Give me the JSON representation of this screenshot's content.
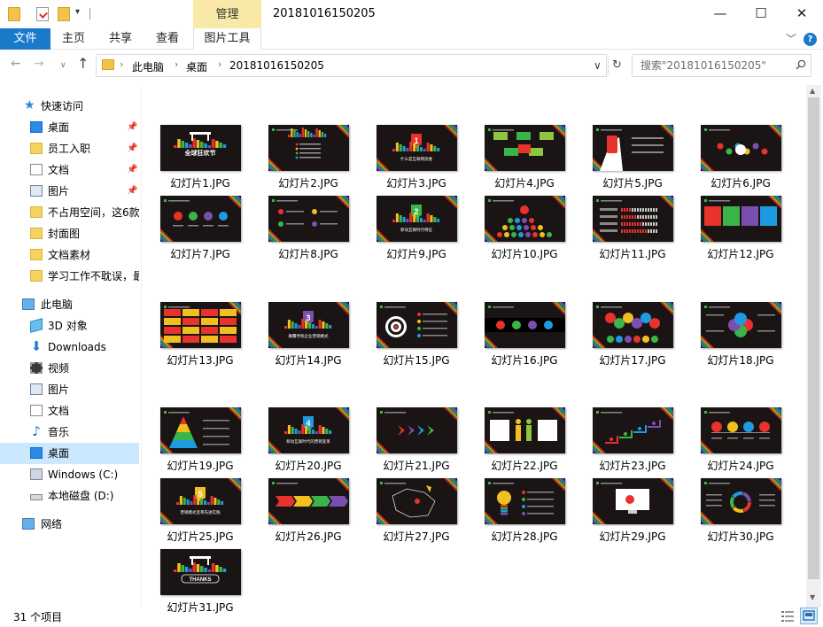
{
  "titlebar": {
    "tool_group": "管理",
    "title": "20181016150205",
    "minimize": "—",
    "maximize": "☐",
    "close": "✕",
    "qa_menu": "▾"
  },
  "ribbon": {
    "tabs": [
      "文件",
      "主页",
      "共享",
      "查看",
      "图片工具"
    ],
    "chevron": "﹀",
    "help": "?"
  },
  "navbar": {
    "back": "←",
    "forward": "→",
    "recent": "∨",
    "up": "↑",
    "breadcrumbs": [
      "此电脑",
      "桌面",
      "20181016150205"
    ],
    "separator": "›",
    "dropdown": "∨",
    "refresh": "↻",
    "search_placeholder": "搜索\"20181016150205\""
  },
  "navpane": {
    "quick_access": "快速访问",
    "items": [
      {
        "label": "桌面",
        "icon": "desktop-icon",
        "pinned": true
      },
      {
        "label": "员工入职",
        "icon": "folder-icon",
        "pinned": true
      },
      {
        "label": "文档",
        "icon": "document-icon",
        "pinned": true
      },
      {
        "label": "图片",
        "icon": "picture-icon",
        "pinned": true
      },
      {
        "label": "不占用空间，这6款",
        "icon": "folder-icon",
        "pinned": false
      },
      {
        "label": "封面图",
        "icon": "folder-icon",
        "pinned": false
      },
      {
        "label": "文档素材",
        "icon": "folder-icon",
        "pinned": false
      },
      {
        "label": "学习工作不耽误，最",
        "icon": "folder-icon",
        "pinned": false
      }
    ],
    "this_pc": "此电脑",
    "pc_items": [
      {
        "label": "3D 对象",
        "icon": "3d-objects-icon"
      },
      {
        "label": "Downloads",
        "icon": "download-icon"
      },
      {
        "label": "视频",
        "icon": "video-icon"
      },
      {
        "label": "图片",
        "icon": "picture-icon"
      },
      {
        "label": "文档",
        "icon": "document-icon"
      },
      {
        "label": "音乐",
        "icon": "music-icon"
      },
      {
        "label": "桌面",
        "icon": "desktop-icon",
        "selected": true
      },
      {
        "label": "Windows (C:)",
        "icon": "windows-drive-icon"
      },
      {
        "label": "本地磁盘 (D:)",
        "icon": "hard-drive-icon"
      }
    ],
    "network": "网络",
    "pin_glyph": "📌"
  },
  "files": [
    {
      "name": "幻灯片1.JPG",
      "thumb": "title",
      "caption": "全球狂欢节"
    },
    {
      "name": "幻灯片2.JPG",
      "thumb": "agenda"
    },
    {
      "name": "幻灯片3.JPG",
      "thumb": "section",
      "num": "1",
      "color": "#e8322c",
      "caption": "什么是互联网思维"
    },
    {
      "name": "幻灯片4.JPG",
      "thumb": "boxes"
    },
    {
      "name": "幻灯片5.JPG",
      "thumb": "phone"
    },
    {
      "name": "幻灯片6.JPG",
      "thumb": "icons"
    },
    {
      "name": "幻灯片7.JPG",
      "thumb": "circles"
    },
    {
      "name": "幻灯片8.JPG",
      "thumb": "list"
    },
    {
      "name": "幻灯片9.JPG",
      "thumb": "section",
      "num": "2",
      "color": "#3bb54a",
      "caption": "移动互联时代特征"
    },
    {
      "name": "幻灯片10.JPG",
      "thumb": "people"
    },
    {
      "name": "幻灯片11.JPG",
      "thumb": "bars"
    },
    {
      "name": "幻灯片12.JPG",
      "thumb": "blocks"
    },
    {
      "name": "幻灯片13.JPG",
      "thumb": "grid"
    },
    {
      "name": "幻灯片14.JPG",
      "thumb": "section",
      "num": "3",
      "color": "#7b4fb0",
      "caption": "颠覆传统企业营销模式"
    },
    {
      "name": "幻灯片15.JPG",
      "thumb": "target"
    },
    {
      "name": "幻灯片16.JPG",
      "thumb": "dots"
    },
    {
      "name": "幻灯片17.JPG",
      "thumb": "bubbles"
    },
    {
      "name": "幻灯片18.JPG",
      "thumb": "flower"
    },
    {
      "name": "幻灯片19.JPG",
      "thumb": "pyramid"
    },
    {
      "name": "幻灯片20.JPG",
      "thumb": "section",
      "num": "4",
      "color": "#1e9be0",
      "caption": "移动互联时代的营销变革"
    },
    {
      "name": "幻灯片21.JPG",
      "thumb": "arrows"
    },
    {
      "name": "幻灯片22.JPG",
      "thumb": "figures"
    },
    {
      "name": "幻灯片23.JPG",
      "thumb": "steps"
    },
    {
      "name": "幻灯片24.JPG",
      "thumb": "pins"
    },
    {
      "name": "幻灯片25.JPG",
      "thumb": "section",
      "num": "5",
      "color": "#f2c01e",
      "caption": "营销模式变革先进实践"
    },
    {
      "name": "幻灯片26.JPG",
      "thumb": "chevrons"
    },
    {
      "name": "幻灯片27.JPG",
      "thumb": "map"
    },
    {
      "name": "幻灯片28.JPG",
      "thumb": "bulb"
    },
    {
      "name": "幻灯片29.JPG",
      "thumb": "monitor"
    },
    {
      "name": "幻灯片30.JPG",
      "thumb": "ring"
    },
    {
      "name": "幻灯片31.JPG",
      "thumb": "thanks",
      "caption": "THANKS"
    }
  ],
  "status": {
    "count": "31 个项目"
  },
  "colors": {
    "accent": "#1979ca",
    "tool_group_bg": "#f8eaa6",
    "selection": "#cce8ff",
    "slide_bg": "#1a1414",
    "stripe": [
      "#e8322c",
      "#f2c01e",
      "#3bb54a",
      "#1e9be0",
      "#7b4fb0"
    ]
  }
}
